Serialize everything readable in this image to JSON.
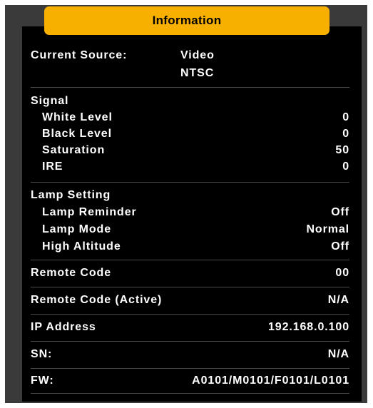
{
  "title": "Information",
  "current_source": {
    "label": "Current Source:",
    "value_line1": "Video",
    "value_line2": "NTSC"
  },
  "signal": {
    "heading": "Signal",
    "items": [
      {
        "label": "White Level",
        "value": "0"
      },
      {
        "label": "Black Level",
        "value": "0"
      },
      {
        "label": "Saturation",
        "value": "50"
      },
      {
        "label": "IRE",
        "value": "0"
      }
    ]
  },
  "lamp": {
    "heading": "Lamp Setting",
    "items": [
      {
        "label": "Lamp Reminder",
        "value": "Off"
      },
      {
        "label": "Lamp Mode",
        "value": "Normal"
      },
      {
        "label": "High Altitude",
        "value": "Off"
      }
    ]
  },
  "remote_code": {
    "label": "Remote Code",
    "value": "00"
  },
  "remote_code_active": {
    "label": "Remote Code (Active)",
    "value": "N/A"
  },
  "ip_address": {
    "label": "IP Address",
    "value": "192.168.0.100"
  },
  "sn": {
    "label": "SN:",
    "value": "N/A"
  },
  "fw": {
    "label": "FW:",
    "value": "A0101/M0101/F0101/L0101"
  },
  "colors": {
    "accent": "#f7b000",
    "frame": "#3a3a3a",
    "background": "#000000",
    "text": "#ffffff"
  }
}
